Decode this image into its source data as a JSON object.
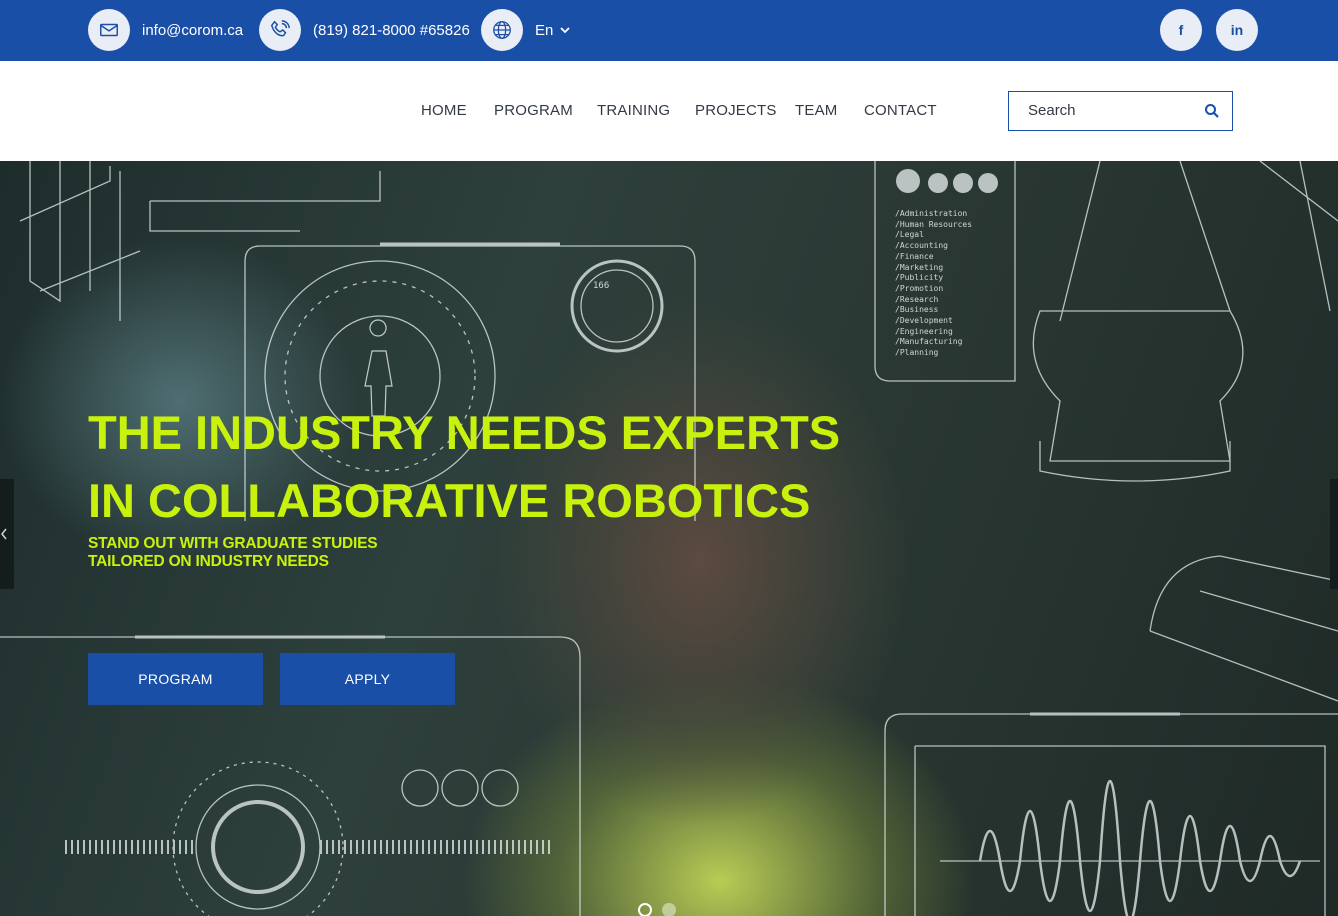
{
  "topbar": {
    "email": "info@corom.ca",
    "phone": "(819) 821-8000 #65826",
    "language": "En",
    "social": {
      "facebook_label": "f",
      "linkedin_label": "in"
    }
  },
  "nav": {
    "items": [
      "HOME",
      "PROGRAM",
      "TRAINING",
      "PROJECTS",
      "TEAM",
      "CONTACT"
    ],
    "search_placeholder": "Search"
  },
  "hero": {
    "headline_line1": "THE INDUSTRY NEEDS EXPERTS",
    "headline_line2": "IN COLLABORATIVE ROBOTICS",
    "subline_line1": "STAND OUT WITH GRADUATE STUDIES",
    "subline_line2": "TAILORED ON INDUSTRY NEEDS",
    "buttons": [
      "PROGRAM",
      "APPLY"
    ],
    "slides_total": 2,
    "active_slide": 1,
    "hud_text": {
      "menu_list": [
        "/Administration",
        "/Human Resources",
        "/Legal",
        "/Accounting",
        "/Finance",
        "/Marketing",
        "/Publicity",
        "/Promotion",
        "/Research",
        "/Business",
        "/Development",
        "/Engineering",
        "/Manufacturing",
        "/Planning"
      ],
      "gauge_value": "166"
    }
  },
  "colors": {
    "brand_blue": "#1a4fa8",
    "accent_lime": "#c8f20d",
    "nav_text": "#333a44"
  },
  "icons": {
    "email": "envelope-icon",
    "phone": "phone-icon",
    "language": "globe-icon",
    "search": "magnifier-icon"
  }
}
